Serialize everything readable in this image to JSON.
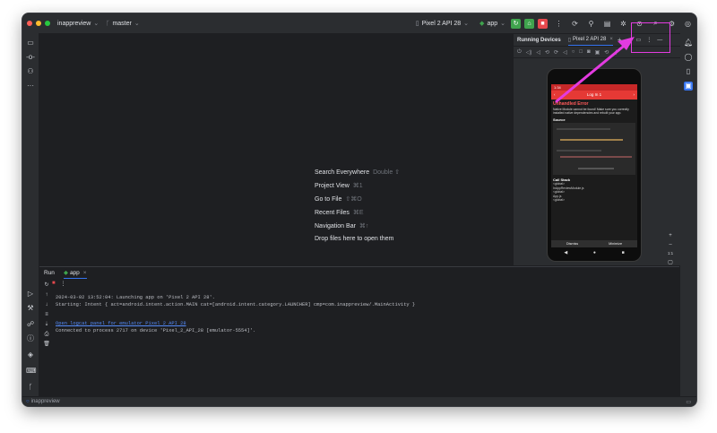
{
  "titlebar": {
    "project": "inappreview",
    "branch": "master",
    "device": "Pixel 2 API 28",
    "run_config": "app"
  },
  "editor_hints": [
    {
      "label": "Search Everywhere",
      "shortcut": "Double ⇧"
    },
    {
      "label": "Project View",
      "shortcut": "⌘1"
    },
    {
      "label": "Go to File",
      "shortcut": "⇧⌘O"
    },
    {
      "label": "Recent Files",
      "shortcut": "⌘E"
    },
    {
      "label": "Navigation Bar",
      "shortcut": "⌘↑"
    },
    {
      "label": "Drop files here to open them",
      "shortcut": ""
    }
  ],
  "running_devices": {
    "title": "Running Devices",
    "tab": "Pixel 2 API 28"
  },
  "phone": {
    "status_time": "1:34",
    "app_title": "Log In 1",
    "error_title": "Unhandled Error",
    "error_body": "Native Module cannot be found! Make sure you correctly installed native dependencies and rebuilt your app.",
    "source_label": "Source",
    "call_stack_label": "Call Stack",
    "call_stack": [
      "<global>",
      "InAppReviewModule.js",
      "<global>",
      "App.js",
      "<global>"
    ],
    "dismiss_label": "Dismiss",
    "minimize_label": "Minimize"
  },
  "run_panel": {
    "tab_run": "Run",
    "tab_app": "app",
    "lines": [
      "2024-03-02 13:52:04: Launching app on 'Pixel 2 API 28'.",
      "Starting: Intent { act=android.intent.action.MAIN cat=[android.intent.category.LAUNCHER] cmp=com.inappreview/.MainActivity }",
      "Open logcat panel for emulator Pixel 2 API 28",
      "Connected to process 2717 on device 'Pixel_2_API_28 [emulator-5554]'."
    ]
  },
  "statusbar": {
    "project": "inappreview"
  },
  "colors": {
    "accent_pink": "#e33be0",
    "run_green": "#3fa34d",
    "stop_red": "#e5484d",
    "error_red": "#e53935",
    "link": "#548af7"
  }
}
